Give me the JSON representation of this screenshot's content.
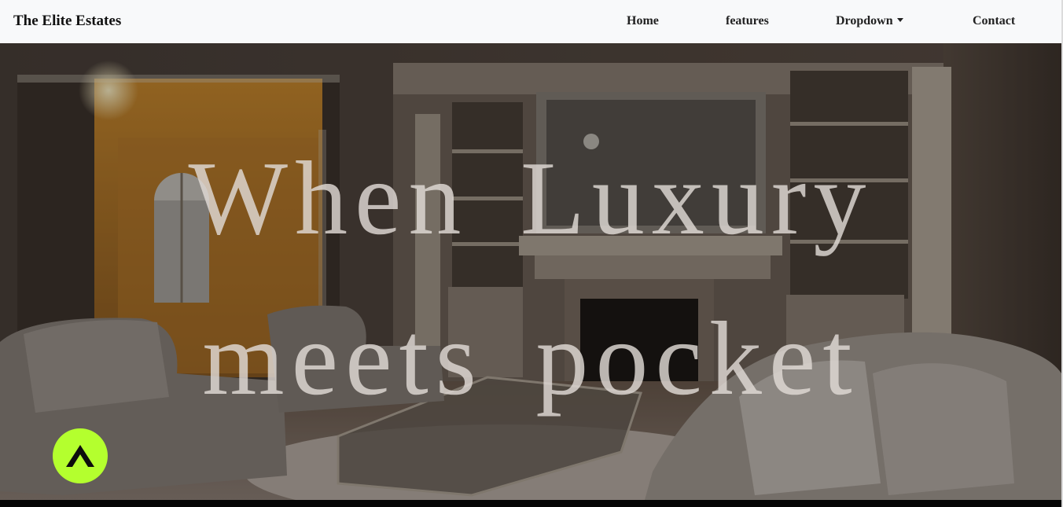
{
  "navbar": {
    "brand": "The Elite Estates",
    "links": {
      "home": "Home",
      "features": "features",
      "dropdown": "Dropdown",
      "contact": "Contact"
    }
  },
  "hero": {
    "headline_line1": "When Luxury",
    "headline_line2": "meets pocket",
    "background_image": "living-room-with-fireplace"
  },
  "back_to_top": {
    "icon": "chevron-up-icon",
    "color": "#b4ff2e"
  },
  "colors": {
    "navbar_bg": "#f8f9fa",
    "accent": "#b4ff2e"
  }
}
